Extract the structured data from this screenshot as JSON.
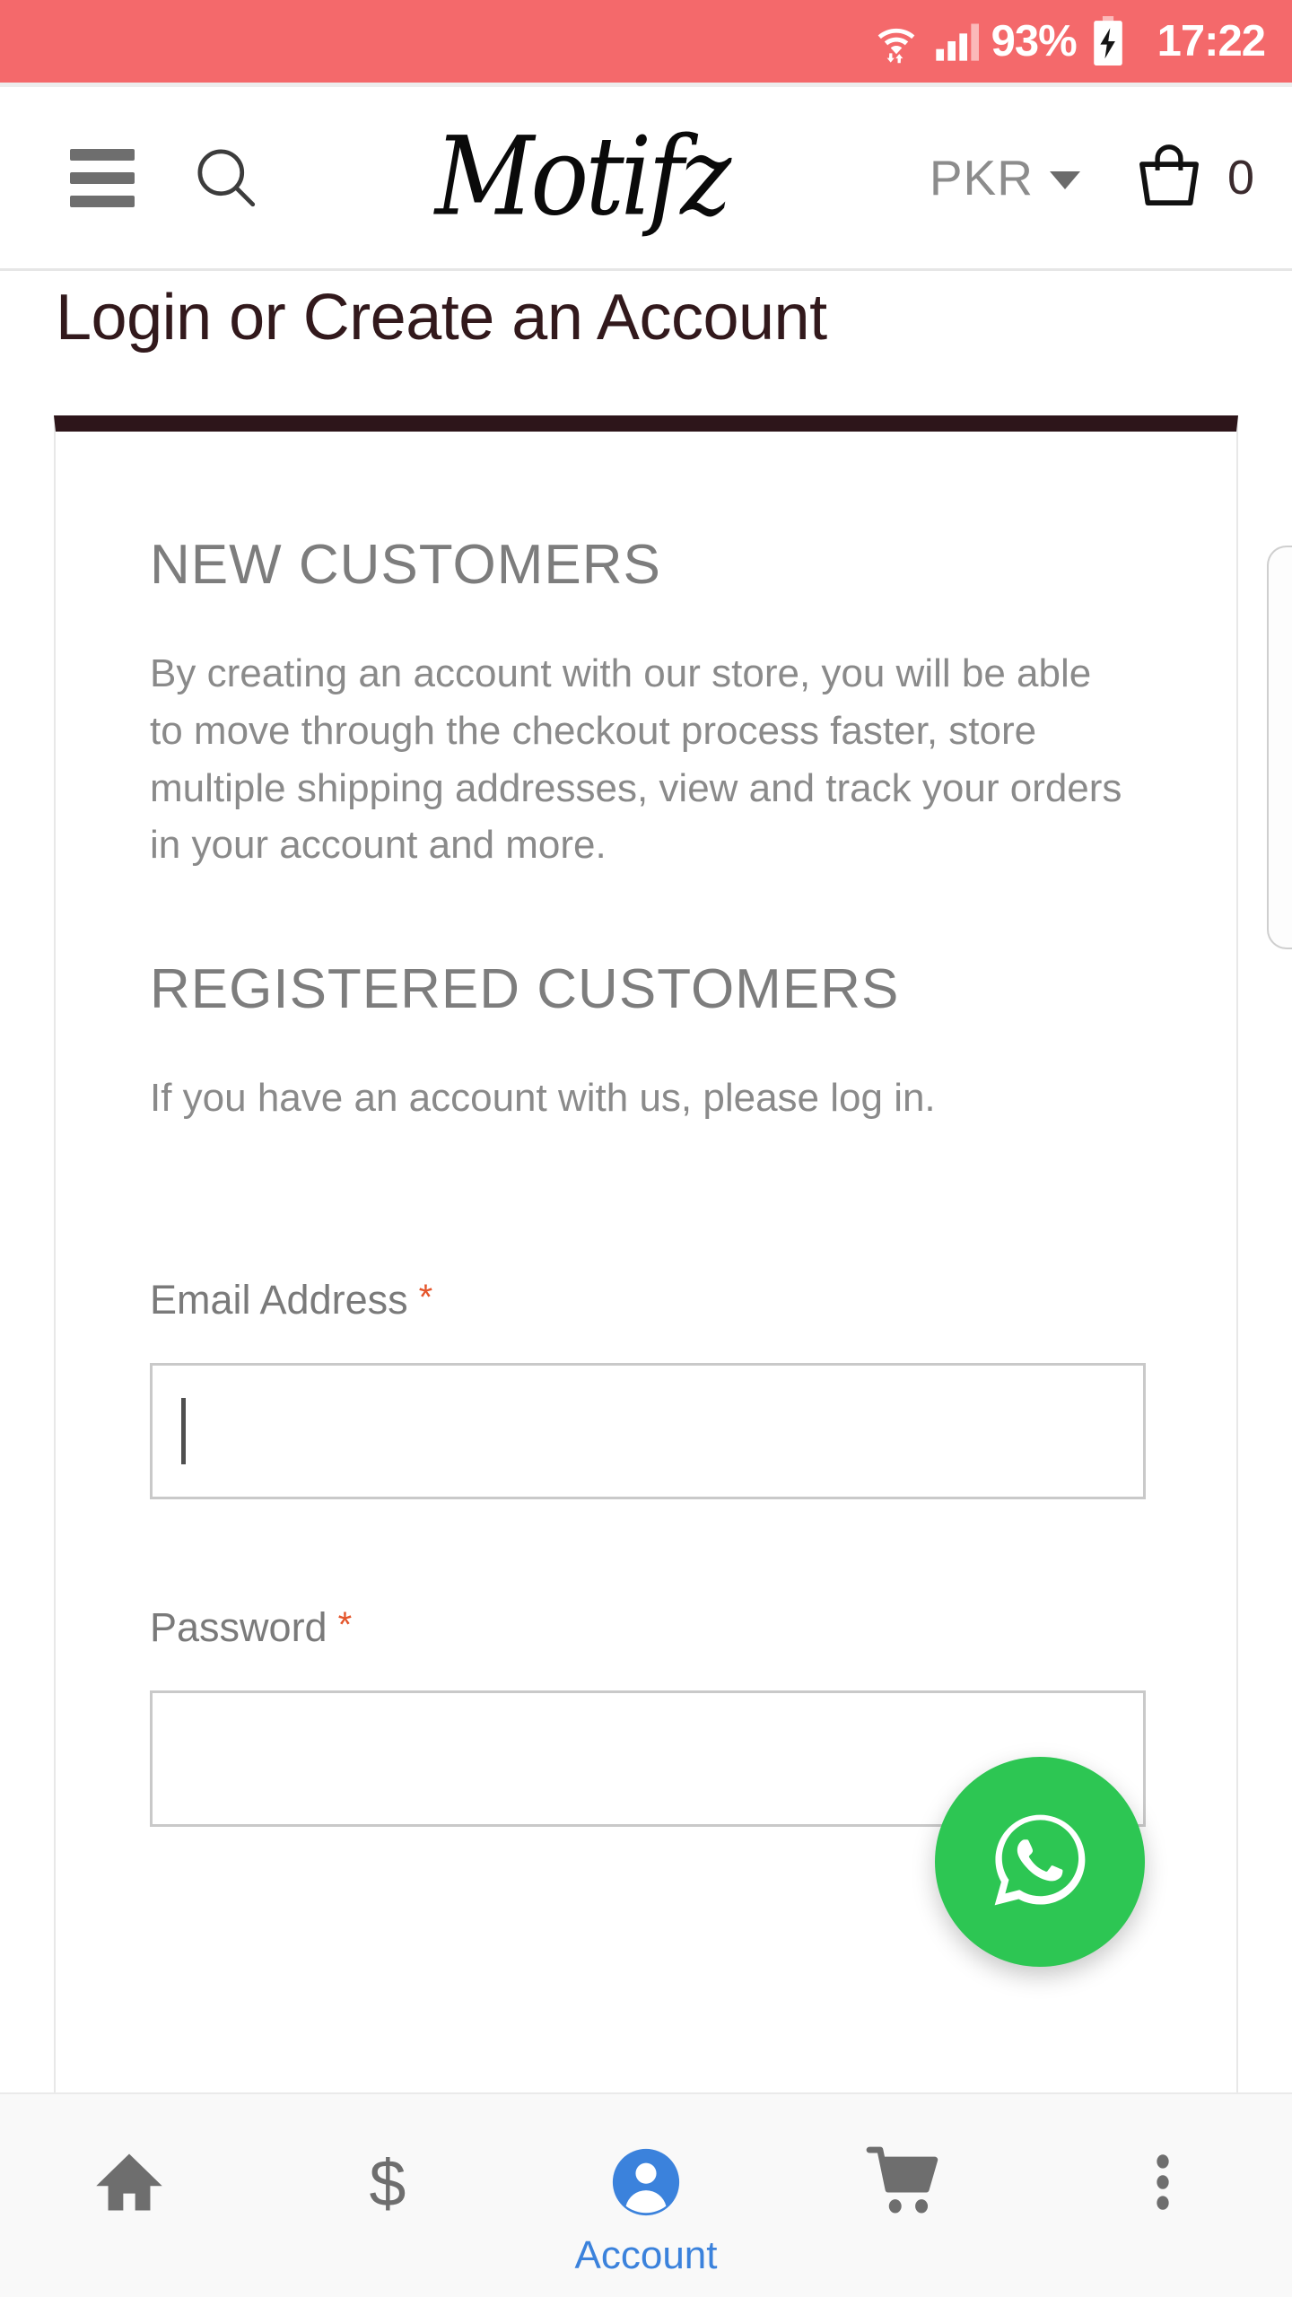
{
  "status_bar": {
    "battery_percent": "93%",
    "time": "17:22",
    "icons": [
      "wifi-data-icon",
      "signal-bars-icon",
      "battery-charging-icon"
    ],
    "background_color": "#F4696B"
  },
  "header": {
    "menu_icon": "hamburger-menu-icon",
    "search_icon": "search-icon",
    "logo_text": "Motifz",
    "currency": "PKR",
    "currency_caret": "chevron-down-icon",
    "cart_icon": "shopping-bag-icon",
    "cart_count": "0"
  },
  "page": {
    "title": "Login or Create an Account"
  },
  "new_customers": {
    "heading": "NEW CUSTOMERS",
    "body": "By creating an account with our store, you will be able to move through the checkout process faster, store multiple shipping addresses, view and track your orders in your account and more."
  },
  "registered_customers": {
    "heading": "REGISTERED CUSTOMERS",
    "body": "If you have an account with us, please log in."
  },
  "form": {
    "email": {
      "label": "Email Address",
      "required_marker": "*",
      "value": "",
      "placeholder": "",
      "focused": true
    },
    "password": {
      "label": "Password",
      "required_marker": "*",
      "value": "",
      "placeholder": "",
      "focused": false
    }
  },
  "whatsapp_button": {
    "icon": "whatsapp-icon",
    "color": "#2DC653"
  },
  "bottom_nav": {
    "items": [
      {
        "icon": "home-icon",
        "label": "",
        "active": false
      },
      {
        "icon": "dollar-sign-icon",
        "label": "",
        "active": false
      },
      {
        "icon": "account-person-icon",
        "label": "Account",
        "active": true
      },
      {
        "icon": "shopping-cart-icon",
        "label": "",
        "active": false
      },
      {
        "icon": "more-vertical-icon",
        "label": "",
        "active": false
      }
    ],
    "active_color": "#3B82DC",
    "inactive_color": "#6E6E6E"
  },
  "colors": {
    "status_bar": "#F4696B",
    "card_top_border": "#2D151A",
    "title": "#32191C",
    "required_star": "#E4552B",
    "whatsapp_green": "#2DC653",
    "nav_active_blue": "#3B82DC"
  }
}
